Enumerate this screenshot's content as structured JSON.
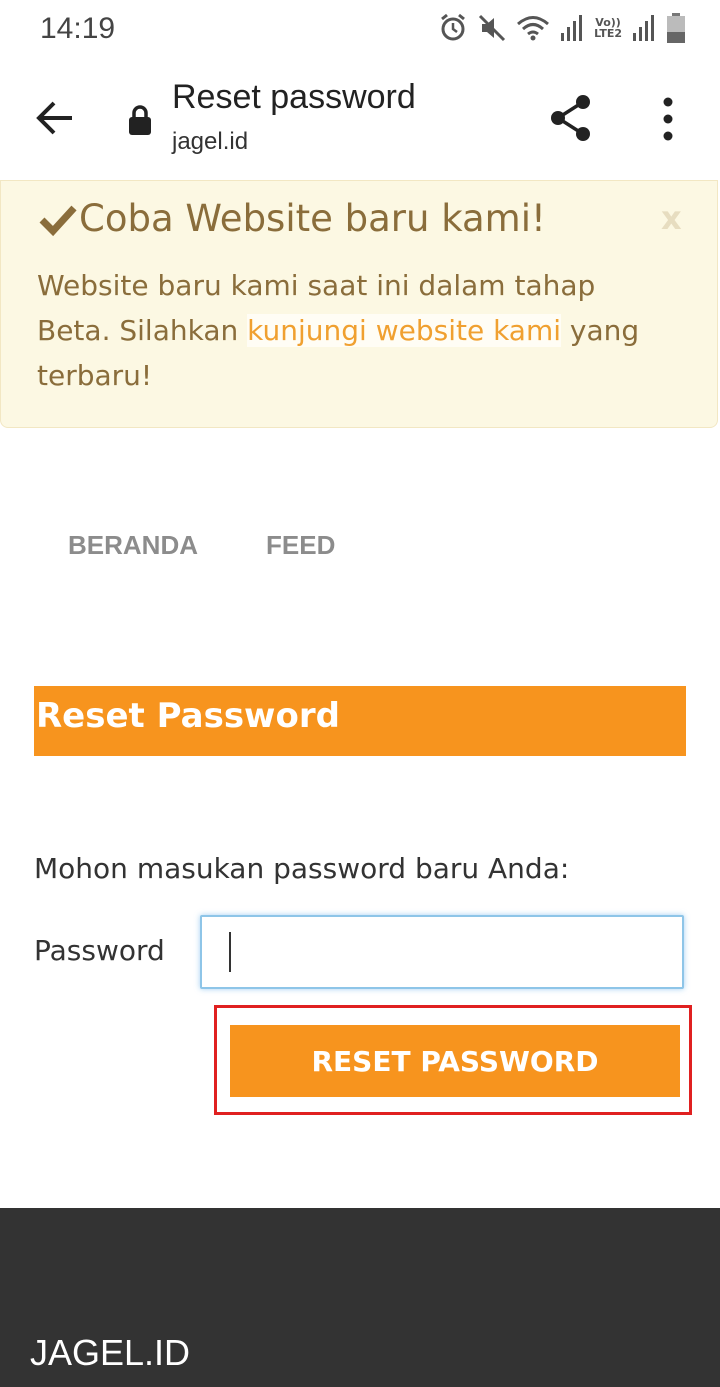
{
  "status_bar": {
    "time": "14:19",
    "lte_top": "Vo))",
    "lte_bottom": "LTE2",
    "icons": [
      "alarm-icon",
      "mute-icon",
      "wifi-icon",
      "signal-icon",
      "signal-icon",
      "battery-icon"
    ]
  },
  "toolbar": {
    "title": "Reset password",
    "url": "jagel.id",
    "icons": [
      "back-arrow-icon",
      "lock-icon",
      "share-icon",
      "more-vert-icon"
    ]
  },
  "banner": {
    "title": "Coba Website baru kami!",
    "close_label": "x",
    "text_before": "Website baru kami saat ini dalam tahap Beta. Silahkan ",
    "link_text": "kunjungi website kami",
    "text_after": " yang terbaru!",
    "icon": "check-icon"
  },
  "nav": {
    "items": [
      {
        "label": "BERANDA"
      },
      {
        "label": "FEED"
      }
    ]
  },
  "panel": {
    "heading": "Reset Password"
  },
  "form": {
    "intro": "Mohon masukan password baru Anda:",
    "password_label": "Password",
    "password_value": "",
    "submit_label": "RESET PASSWORD"
  },
  "footer": {
    "brand": "JAGEL.ID"
  },
  "colors": {
    "accent_orange": "#f7941e",
    "banner_bg": "#fcf8e3",
    "banner_text": "#8a6d3b",
    "footer_bg": "#333333",
    "highlight_red": "#e02020"
  }
}
